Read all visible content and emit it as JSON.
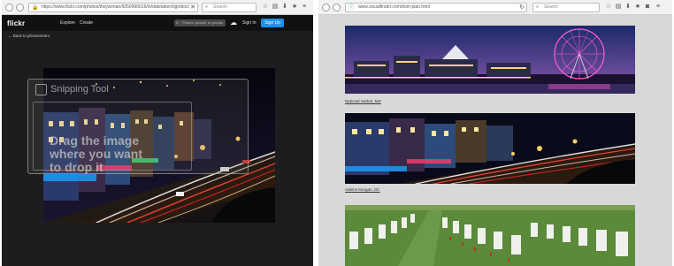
{
  "left_window": {
    "url": "https://www.flickr.com/photos/theyarman/6050960016/in/datetaken/lightbox/",
    "search_placeholder": "Search",
    "flickr": {
      "logo": "flickr",
      "nav": [
        "Explore",
        "Create"
      ],
      "search_placeholder": "Photos, people, or groups",
      "sign_in": "Sign In",
      "sign_up": "Sign Up"
    },
    "back_link": "Back to photostream",
    "overlay": {
      "snip_label": "Snipping Tool",
      "drag_text": "Drag the image where you want to drop it"
    }
  },
  "right_window": {
    "url": "www.visualfinder.com/dom-plan.html",
    "search_placeholder": "Search",
    "captions": [
      "National Harbor, MD",
      "Adams Morgan, DC"
    ]
  }
}
